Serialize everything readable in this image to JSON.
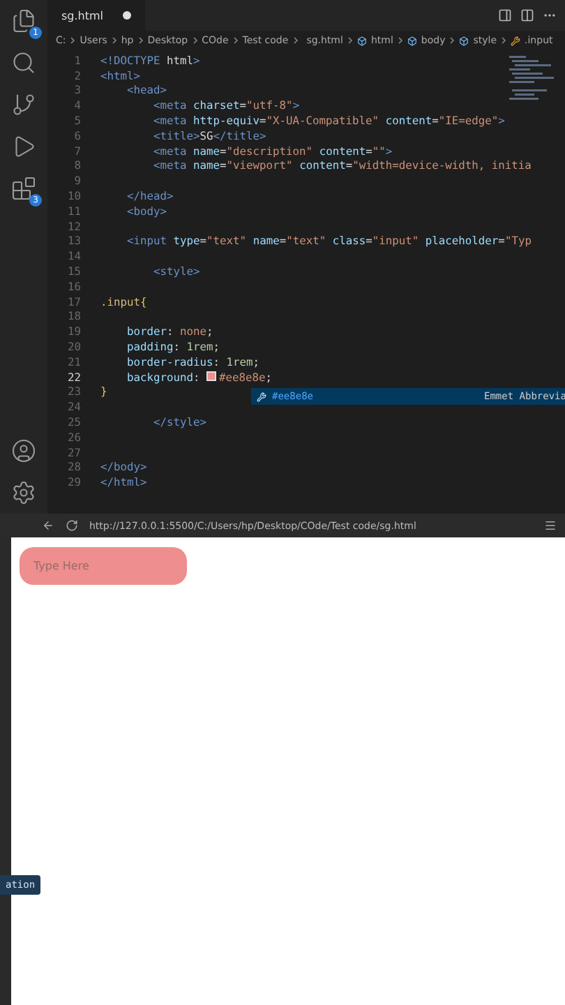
{
  "activity_bar": [
    {
      "kind": "files",
      "badge": "1"
    },
    {
      "kind": "search"
    },
    {
      "kind": "source-control"
    },
    {
      "kind": "run"
    },
    {
      "kind": "extensions",
      "badge": "3"
    }
  ],
  "activity_bar_bottom": [
    {
      "kind": "account"
    },
    {
      "kind": "settings"
    }
  ],
  "tab": {
    "label": "sg.html",
    "modified": true
  },
  "breadcrumb": [
    {
      "label": "C:",
      "kind": "folder"
    },
    {
      "label": "Users",
      "kind": "folder"
    },
    {
      "label": "hp",
      "kind": "folder"
    },
    {
      "label": "Desktop",
      "kind": "folder"
    },
    {
      "label": "COde",
      "kind": "folder"
    },
    {
      "label": "Test code",
      "kind": "folder"
    },
    {
      "label": "sg.html",
      "kind": "file"
    },
    {
      "label": "html",
      "kind": "element"
    },
    {
      "label": "body",
      "kind": "element"
    },
    {
      "label": "style",
      "kind": "element"
    },
    {
      "label": ".input",
      "kind": "selector"
    }
  ],
  "code_lines": [
    {
      "number": "1",
      "active": false,
      "segments": [
        {
          "text": "<!DOCTYPE ",
          "kind": "tag"
        },
        {
          "text": "html",
          "kind": "plain"
        },
        {
          "text": ">",
          "kind": "tag"
        }
      ]
    },
    {
      "number": "2",
      "active": false,
      "segments": [
        {
          "text": "<html>",
          "kind": "tag"
        }
      ]
    },
    {
      "number": "3",
      "active": false,
      "segments": [
        {
          "text": "    <head>",
          "kind": "tag"
        }
      ]
    },
    {
      "number": "4",
      "active": false,
      "segments": [
        {
          "text": "        <meta ",
          "kind": "tag"
        },
        {
          "text": "charset",
          "kind": "attr"
        },
        {
          "text": "=",
          "kind": "plain"
        },
        {
          "text": "\"utf-8\"",
          "kind": "string"
        },
        {
          "text": ">",
          "kind": "tag"
        }
      ]
    },
    {
      "number": "5",
      "active": false,
      "segments": [
        {
          "text": "        <meta ",
          "kind": "tag"
        },
        {
          "text": "http-equiv",
          "kind": "attr"
        },
        {
          "text": "=",
          "kind": "plain"
        },
        {
          "text": "\"X-UA-Compatible\"",
          "kind": "string"
        },
        {
          "text": " content",
          "kind": "attr"
        },
        {
          "text": "=",
          "kind": "plain"
        },
        {
          "text": "\"IE=edge\"",
          "kind": "string"
        },
        {
          "text": ">",
          "kind": "tag"
        }
      ]
    },
    {
      "number": "6",
      "active": false,
      "segments": [
        {
          "text": "        <title>",
          "kind": "tag"
        },
        {
          "text": "SG",
          "kind": "plain"
        },
        {
          "text": "</title>",
          "kind": "tag"
        }
      ]
    },
    {
      "number": "7",
      "active": false,
      "segments": [
        {
          "text": "        <meta ",
          "kind": "tag"
        },
        {
          "text": "name",
          "kind": "attr"
        },
        {
          "text": "=",
          "kind": "plain"
        },
        {
          "text": "\"description\"",
          "kind": "string"
        },
        {
          "text": " content",
          "kind": "attr"
        },
        {
          "text": "=",
          "kind": "plain"
        },
        {
          "text": "\"\"",
          "kind": "string"
        },
        {
          "text": ">",
          "kind": "tag"
        }
      ]
    },
    {
      "number": "8",
      "active": false,
      "segments": [
        {
          "text": "        <meta ",
          "kind": "tag"
        },
        {
          "text": "name",
          "kind": "attr"
        },
        {
          "text": "=",
          "kind": "plain"
        },
        {
          "text": "\"viewport\"",
          "kind": "string"
        },
        {
          "text": " content",
          "kind": "attr"
        },
        {
          "text": "=",
          "kind": "plain"
        },
        {
          "text": "\"width=device-width, initia",
          "kind": "string"
        }
      ]
    },
    {
      "number": "9",
      "active": false
    },
    {
      "number": "10",
      "active": false,
      "segments": [
        {
          "text": "    </head>",
          "kind": "tag"
        }
      ]
    },
    {
      "number": "11",
      "active": false,
      "segments": [
        {
          "text": "    <body>",
          "kind": "tag"
        }
      ]
    },
    {
      "number": "12",
      "active": false
    },
    {
      "number": "13",
      "active": false,
      "segments": [
        {
          "text": "    <input ",
          "kind": "tag"
        },
        {
          "text": "type",
          "kind": "attr"
        },
        {
          "text": "=",
          "kind": "plain"
        },
        {
          "text": "\"text\"",
          "kind": "string"
        },
        {
          "text": " name",
          "kind": "attr"
        },
        {
          "text": "=",
          "kind": "plain"
        },
        {
          "text": "\"text\"",
          "kind": "string"
        },
        {
          "text": " class",
          "kind": "attr"
        },
        {
          "text": "=",
          "kind": "plain"
        },
        {
          "text": "\"input\"",
          "kind": "string"
        },
        {
          "text": " placeholder",
          "kind": "attr"
        },
        {
          "text": "=",
          "kind": "plain"
        },
        {
          "text": "\"Typ",
          "kind": "string"
        }
      ]
    },
    {
      "number": "14",
      "active": false
    },
    {
      "number": "15",
      "active": false,
      "segments": [
        {
          "text": "        <style>",
          "kind": "tag"
        }
      ]
    },
    {
      "number": "16",
      "active": false
    },
    {
      "number": "17",
      "active": false,
      "segments": [
        {
          "text": ".input",
          "kind": "selector"
        },
        {
          "text": "{",
          "kind": "brace"
        }
      ]
    },
    {
      "number": "18",
      "active": false
    },
    {
      "number": "19",
      "active": false,
      "segments": [
        {
          "text": "    border",
          "kind": "prop"
        },
        {
          "text": ": ",
          "kind": "plain"
        },
        {
          "text": "none",
          "kind": "value"
        },
        {
          "text": ";",
          "kind": "plain"
        }
      ]
    },
    {
      "number": "20",
      "active": false,
      "segments": [
        {
          "text": "    padding",
          "kind": "prop"
        },
        {
          "text": ": ",
          "kind": "plain"
        },
        {
          "text": "1rem",
          "kind": "number"
        },
        {
          "text": ";",
          "kind": "plain"
        }
      ]
    },
    {
      "number": "21",
      "active": false,
      "segments": [
        {
          "text": "    border-radius",
          "kind": "prop"
        },
        {
          "text": ": ",
          "kind": "plain"
        },
        {
          "text": "1rem",
          "kind": "number"
        },
        {
          "text": ";",
          "kind": "plain"
        }
      ]
    },
    {
      "number": "22",
      "active": true,
      "segments": [
        {
          "text": "    background",
          "kind": "prop"
        },
        {
          "text": ": ",
          "kind": "plain"
        },
        {
          "kind": "swatch",
          "color": "#ee8e8e"
        },
        {
          "text": "#ee8e8e",
          "kind": "value"
        },
        {
          "text": ";",
          "kind": "plain"
        }
      ]
    },
    {
      "number": "23",
      "active": false,
      "segments": [
        {
          "text": "}",
          "kind": "brace"
        }
      ]
    },
    {
      "number": "24",
      "active": false
    },
    {
      "number": "25",
      "active": false,
      "segments": [
        {
          "text": "        </style>",
          "kind": "tag"
        }
      ]
    },
    {
      "number": "26",
      "active": false
    },
    {
      "number": "27",
      "active": false
    },
    {
      "number": "28",
      "active": false,
      "segments": [
        {
          "text": "</body>",
          "kind": "tag"
        }
      ]
    },
    {
      "number": "29",
      "active": false,
      "segments": [
        {
          "text": "</html>",
          "kind": "tag"
        }
      ]
    }
  ],
  "suggestion": {
    "label": "#ee8e8e",
    "detail": "Emmet Abbrevia"
  },
  "browser": {
    "url": "http://127.0.0.1:5500/C:/Users/hp/Desktop/COde/Test code/sg.html",
    "input": {
      "placeholder": "Type Here",
      "color": "#ee8e8e"
    }
  },
  "tooltip": "ation"
}
